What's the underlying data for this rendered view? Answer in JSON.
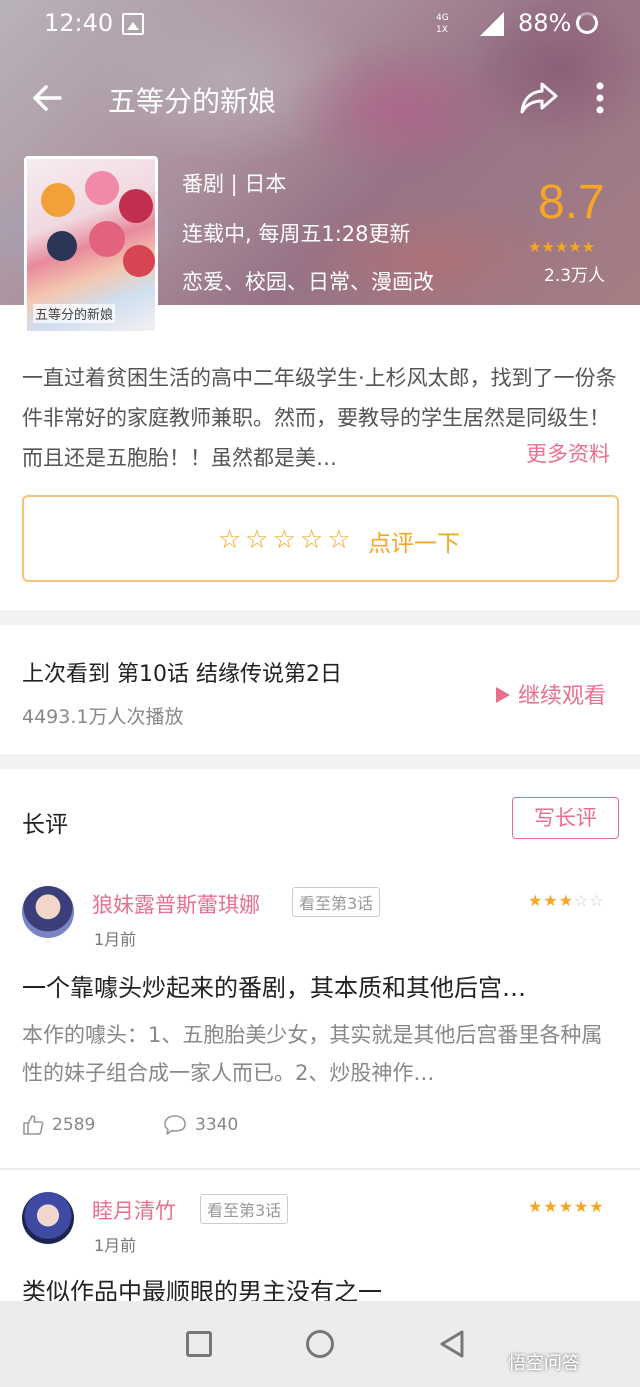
{
  "status": {
    "time": "12:40",
    "network": "4G",
    "network_sub": "1X",
    "battery": "88%"
  },
  "header": {
    "title": "五等分的新娘"
  },
  "anime": {
    "cover_caption": "五等分的新娘",
    "meta_line1": "番剧 | 日本",
    "meta_line2": "连载中, 每周五1:28更新",
    "meta_line3": "恋爱、校园、日常、漫画改",
    "score": "8.7",
    "score_stars": "★★★★★",
    "score_count": "2.3万人",
    "description": "一直过着贫困生活的高中二年级学生·上杉风太郎，找到了一份条件非常好的家庭教师兼职。然而，要教导的学生居然是同级生！而且还是五胞胎！！虽然都是美…",
    "more_label": "更多资料"
  },
  "rate": {
    "stars": "☆☆☆☆☆",
    "label": "点评一下"
  },
  "watch": {
    "last_watched": "上次看到 第10话 结缘传说第2日",
    "plays": "4493.1万人次播放",
    "continue_label": "继续观看"
  },
  "reviews_section": {
    "title": "长评",
    "write_label": "写长评"
  },
  "reviews": [
    {
      "user": "狼妹露普斯蕾琪娜",
      "progress": "看至第3话",
      "ago": "1月前",
      "stars_on": "★★★",
      "stars_off": "☆☆",
      "title": "一个靠噱头炒起来的番剧，其本质和其他后宫…",
      "body": "本作的噱头：1、五胞胎美少女，其实就是其他后宫番里各种属性的妹子组合成一家人而已。2、炒股神作…",
      "likes": "2589",
      "comments": "3340"
    },
    {
      "user": "睦月清竹",
      "progress": "看至第3话",
      "ago": "1月前",
      "stars_on": "★★★★★",
      "stars_off": "",
      "title": "类似作品中最顺眼的男主没有之一"
    }
  ],
  "watermark": "悟空问答",
  "colors": {
    "accent_pink": "#ea6f8e",
    "accent_orange": "#f5a623"
  }
}
